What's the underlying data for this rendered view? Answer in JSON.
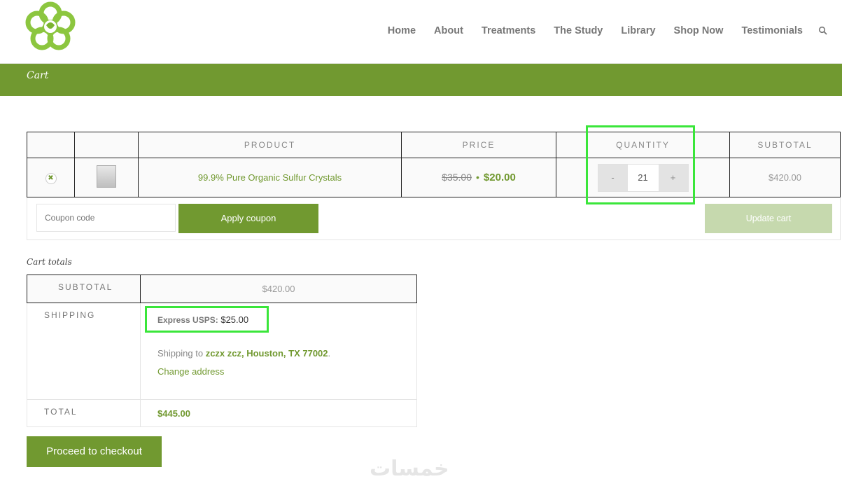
{
  "nav": {
    "items": [
      "Home",
      "About",
      "Treatments",
      "The Study",
      "Library",
      "Shop Now",
      "Testimonials"
    ]
  },
  "page_title": "Cart",
  "cart": {
    "headers": {
      "remove": "",
      "thumbnail": "",
      "product": "PRODUCT",
      "price": "PRICE",
      "quantity": "QUANTITY",
      "subtotal": "SUBTOTAL"
    },
    "item": {
      "remove_symbol": "✖",
      "name": "99.9% Pure Organic Sulfur Crystals",
      "price_old": "$35.00",
      "price_separator": "•",
      "price_new": "$20.00",
      "qty_minus": "-",
      "qty_value": "21",
      "qty_plus": "+",
      "subtotal": "$420.00"
    },
    "coupon_placeholder": "Coupon code",
    "apply_label": "Apply coupon",
    "update_label": "Update cart"
  },
  "totals": {
    "heading": "Cart totals",
    "subtotal_label": "SUBTOTAL",
    "subtotal_value": "$420.00",
    "shipping_label": "SHIPPING",
    "shipping_method": "Express USPS:",
    "shipping_price": "$25.00",
    "shipping_to_prefix": "Shipping to",
    "shipping_address": "zczx zcz, Houston, TX 77002",
    "shipping_to_suffix": ".",
    "change_address": "Change address",
    "total_label": "TOTAL",
    "total_value": "$445.00"
  },
  "checkout_label": "Proceed to checkout",
  "watermark": "خمسات",
  "colors": {
    "brand_green": "#719930",
    "highlight": "#3ae63a",
    "update_disabled": "#c6d9ae"
  }
}
